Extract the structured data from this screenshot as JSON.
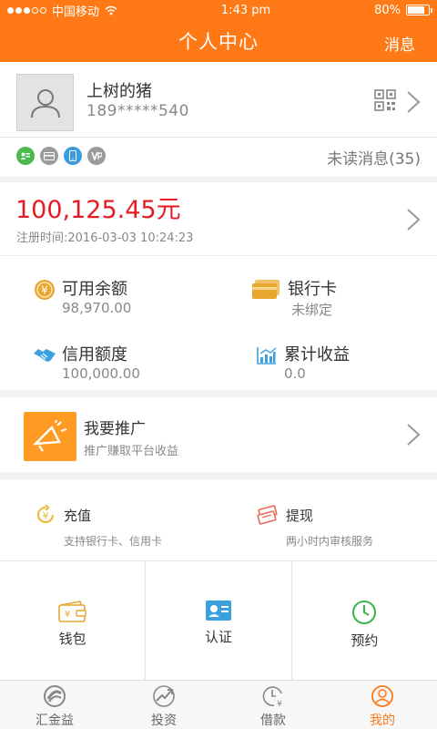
{
  "status_bar": {
    "carrier": "中国移动",
    "time": "1:43 pm",
    "battery": "80%",
    "battery_level": 0.8
  },
  "navbar": {
    "title": "个人中心",
    "messages_label": "消息"
  },
  "profile": {
    "username": "上树的猪",
    "phone": "189*****540",
    "badges": [
      "id-card-icon",
      "bank-card-icon",
      "phone-icon",
      "vip-icon"
    ],
    "unread_label": "未读消息(35)"
  },
  "balance": {
    "amount": "100,125.45元",
    "register_time": "注册时间:2016-03-03 10:24:23"
  },
  "stats": [
    {
      "label": "可用余额",
      "value": "98,970.00",
      "icon": "yuan-coin-icon"
    },
    {
      "label": "银行卡",
      "value": "未绑定",
      "icon": "bank-card-icon"
    },
    {
      "label": "信用额度",
      "value": "100,000.00",
      "icon": "handshake-icon"
    },
    {
      "label": "累计收益",
      "value": "0.0",
      "icon": "bar-chart-icon"
    }
  ],
  "promo": {
    "title": "我要推广",
    "subtitle": "推广赚取平台收益"
  },
  "actions": {
    "recharge": {
      "label": "充值",
      "sub": "支持银行卡、信用卡"
    },
    "withdraw": {
      "label": "提现",
      "sub": "两小时内审核服务"
    }
  },
  "grid": [
    {
      "label": "钱包",
      "icon": "wallet-icon"
    },
    {
      "label": "认证",
      "icon": "id-card-icon"
    },
    {
      "label": "预约",
      "icon": "clock-icon"
    }
  ],
  "tabs": [
    {
      "label": "汇金益",
      "icon": "logo-icon",
      "active": false
    },
    {
      "label": "投资",
      "icon": "trend-icon",
      "active": false
    },
    {
      "label": "借款",
      "icon": "loan-clock-icon",
      "active": false
    },
    {
      "label": "我的",
      "icon": "user-icon",
      "active": true
    }
  ],
  "colors": {
    "brand": "#ff7a17",
    "amount": "#e51c23",
    "promo_box": "#ff9a22"
  }
}
